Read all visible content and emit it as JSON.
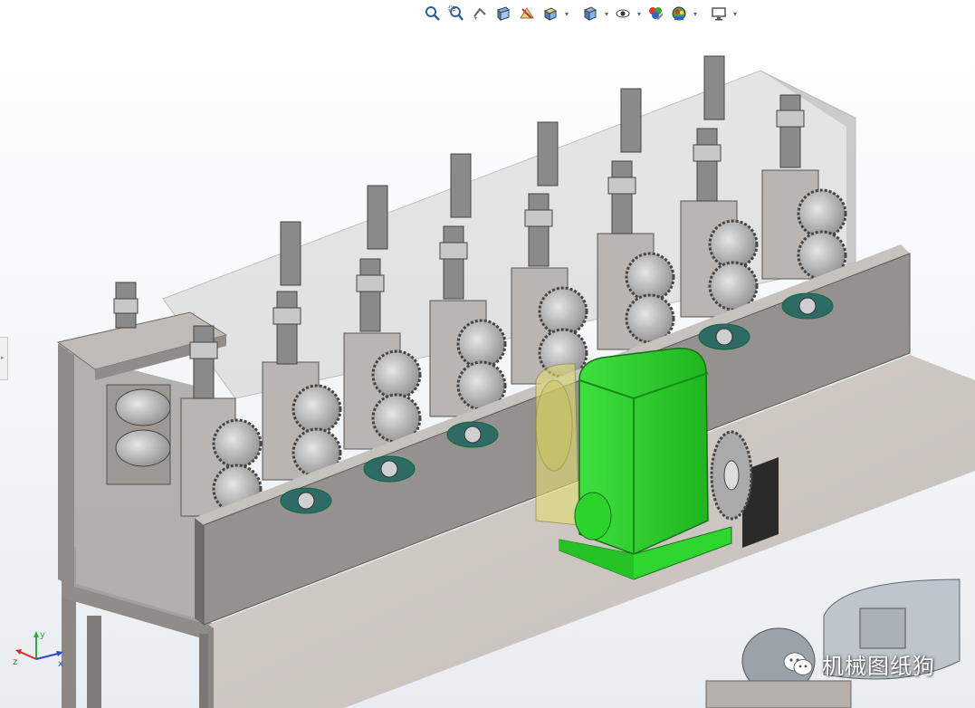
{
  "app": {
    "window": "3D model viewport"
  },
  "toolbar": {
    "buttons": [
      {
        "name": "zoom-to-fit-icon"
      },
      {
        "name": "zoom-to-area-icon"
      },
      {
        "name": "previous-view-icon"
      },
      {
        "name": "section-view-icon"
      },
      {
        "name": "dynamic-annotation-icon"
      },
      {
        "name": "view-orientation-icon"
      },
      {
        "name": "display-style-icon"
      },
      {
        "name": "hide-show-items-icon"
      },
      {
        "name": "edit-appearance-icon"
      },
      {
        "name": "apply-scene-icon"
      },
      {
        "name": "view-settings-icon"
      }
    ]
  },
  "triad": {
    "x_label": "x",
    "y_label": "y",
    "z_label": "z"
  },
  "watermark": {
    "text": "机械图纸狗",
    "logo_icon": "wechat-icon"
  },
  "colors": {
    "frame": "#8c8a88",
    "frame_dark": "#5e5c5a",
    "table_top": "#cfc9c4",
    "motor": "#2fd62f",
    "motor_dark": "#1a9a1a",
    "gear": "#b5b5b5",
    "bearing": "#2d6b66",
    "coupling": "#e0dc72",
    "enclosure": "#9a9a98"
  }
}
